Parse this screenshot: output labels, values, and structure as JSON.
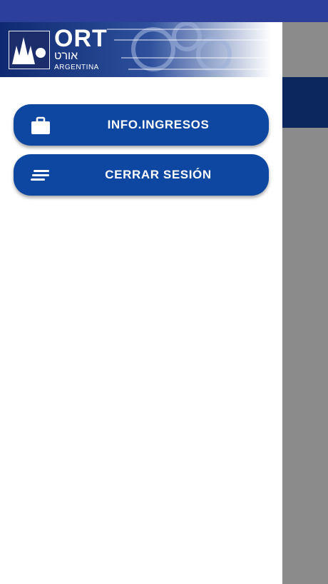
{
  "status_bar": {
    "color": "#2c3f9a"
  },
  "header": {
    "logo_text": "ORT",
    "logo_hebrew": "אורט",
    "logo_country": "ARGENTINA"
  },
  "menu": {
    "items": [
      {
        "label": "INFO.INGRESOS",
        "icon": "briefcase-icon"
      },
      {
        "label": "CERRAR SESIÓN",
        "icon": "sort-lines-icon"
      }
    ]
  },
  "colors": {
    "button": "#0d47a1",
    "toolbar_behind": "#0b275c",
    "scrim": "#8b8b8b"
  }
}
